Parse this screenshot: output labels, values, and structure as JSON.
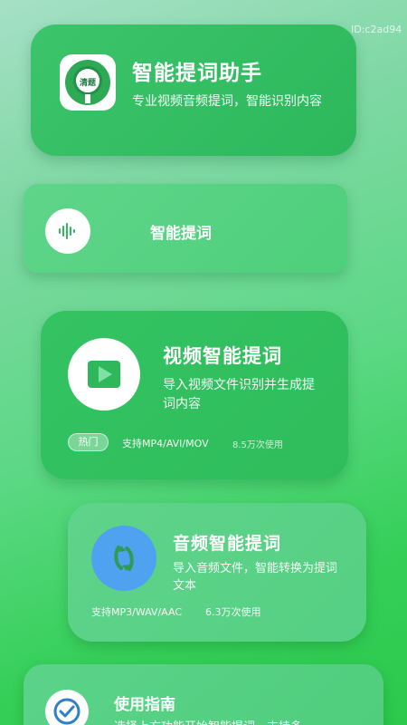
{
  "watermark": "ID:c2ad94",
  "assistant": {
    "logo_text": "清题",
    "title": "智能提词助手",
    "description": "专业视频音频提词，智能识别内容"
  },
  "smart_prompt": {
    "label": "智能提词"
  },
  "video": {
    "title": "视频智能提词",
    "description": "导入视频文件识别并生成提词内容",
    "badge": "热门",
    "formats": "支持MP4/AVI/MOV",
    "usage": "8.5万次使用"
  },
  "audio": {
    "title": "音频智能提词",
    "description": "导入音频文件，智能转换为提词文本",
    "formats": "支持MP3/WAV/AAC",
    "usage": "6.3万次使用"
  },
  "guide": {
    "title": "使用指南",
    "description": "选择上方功能开始智能提词，支持多"
  },
  "colors": {
    "primary_green": "#2db85c",
    "audio_blue": "#4fa2f0"
  }
}
